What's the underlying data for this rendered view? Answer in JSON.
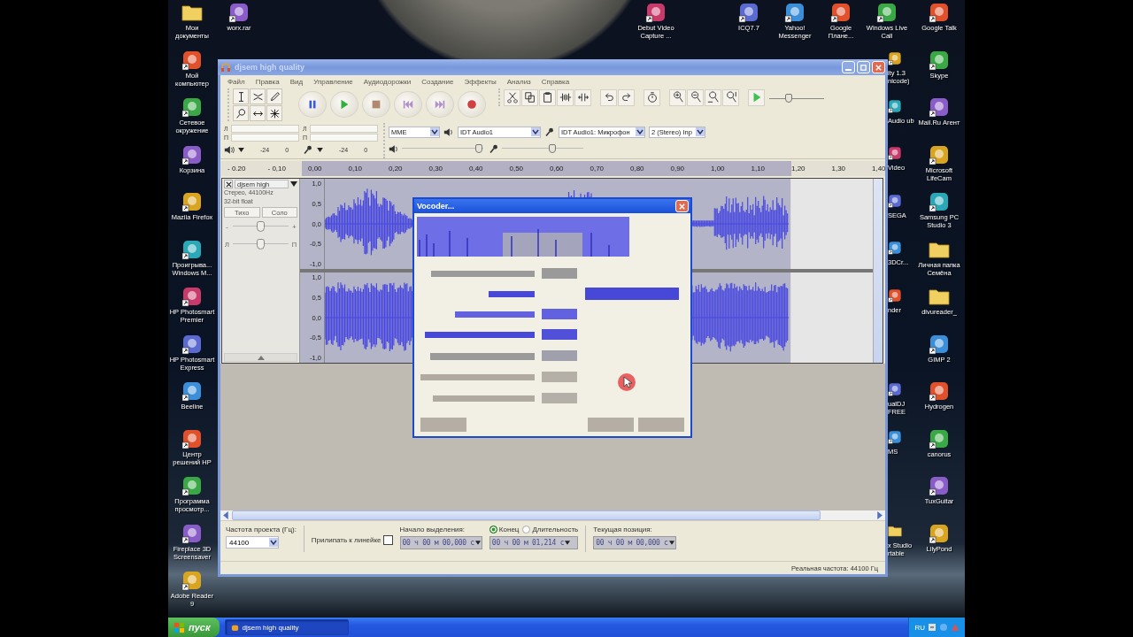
{
  "desktop": {
    "left_column": [
      {
        "label": "Мои документы",
        "kind": "folder"
      },
      {
        "label": "Мой компьютер",
        "kind": "app"
      },
      {
        "label": "Сетевое окружение",
        "kind": "app"
      },
      {
        "label": "Корзина",
        "kind": "app"
      },
      {
        "label": "Mazila Firefox",
        "kind": "app"
      },
      {
        "label": "Проигрыва... Windows M...",
        "kind": "app"
      },
      {
        "label": "HP Photosmart Premier",
        "kind": "app"
      },
      {
        "label": "HP Photosmart Express",
        "kind": "app"
      },
      {
        "label": "Beeline",
        "kind": "app"
      },
      {
        "label": "Центр решений HP",
        "kind": "app"
      },
      {
        "label": "Программа просмотр...",
        "kind": "app"
      },
      {
        "label": "Fireplace 3D Screensaver",
        "kind": "app"
      },
      {
        "label": "Adobe Reader 9",
        "kind": "app"
      }
    ],
    "second_column": [
      {
        "label": "worx.rar",
        "kind": "app"
      }
    ],
    "top_row": [
      {
        "label": "Debut Video Capture ...",
        "kind": "app"
      },
      {
        "label": "ICQ7.7",
        "kind": "app"
      },
      {
        "label": "Yahoo! Messenger",
        "kind": "app"
      },
      {
        "label": "Google Плане...",
        "kind": "app"
      },
      {
        "label": "Windows Live Call",
        "kind": "app"
      }
    ],
    "right_column": [
      {
        "label": "Google Talk",
        "kind": "app"
      },
      {
        "label": "Skype",
        "kind": "app"
      },
      {
        "label": "Mail.Ru Агент",
        "kind": "app"
      },
      {
        "label": "Microsoft LifeCam",
        "kind": "app"
      },
      {
        "label": "Samsung PC Studio 3",
        "kind": "app"
      },
      {
        "label": "Личная папка Семёна",
        "kind": "folder"
      },
      {
        "label": "divureader_",
        "kind": "folder"
      },
      {
        "label": "GIMP 2",
        "kind": "app"
      },
      {
        "label": "Hydrogen",
        "kind": "app"
      },
      {
        "label": "canorus",
        "kind": "app"
      },
      {
        "label": "TuxGuitar",
        "kind": "app"
      },
      {
        "label": "LilyPond",
        "kind": "app"
      }
    ],
    "partly_hidden_upper": [
      {
        "label": "ity 1.3 nicode)",
        "kind": "app"
      },
      {
        "label": "Audio ub",
        "kind": "app"
      },
      {
        "label": "Video",
        "kind": "app"
      },
      {
        "label": "SEGA",
        "kind": "app"
      },
      {
        "label": "3DCr...",
        "kind": "app"
      },
      {
        "label": "nder",
        "kind": "app"
      }
    ],
    "partly_hidden_lower": [
      {
        "label": "ualDJ FREE",
        "kind": "app"
      },
      {
        "label": "MS",
        "kind": "app"
      }
    ],
    "partly_hidden_bottom": [
      {
        "label": "x Studio rtable",
        "kind": "folder"
      }
    ]
  },
  "window": {
    "title": "djsem high quality",
    "menu": [
      "Файл",
      "Правка",
      "Вид",
      "Управление",
      "Аудиодорожки",
      "Создание",
      "Эффекты",
      "Анализ",
      "Справка"
    ],
    "play_speed": {
      "level": 0.35
    },
    "meter": {
      "playback_channels": [
        "Л",
        "П"
      ],
      "record_channels": [
        "Л",
        "П"
      ],
      "playback_scale": [
        "-24",
        "0"
      ],
      "record_scale": [
        "-24",
        "0"
      ]
    },
    "device": {
      "host": "MME",
      "output": "IDT Audio1",
      "input": "IDT Audio1: Микрофон",
      "channels": "2 (Stereo) Inp"
    },
    "mixer": [
      {
        "kind": "output",
        "level": 0.95
      },
      {
        "kind": "input",
        "level": 0.62
      }
    ],
    "ruler": [
      "- 0.20",
      "- 0,10",
      "0,00",
      "0,10",
      "0,20",
      "0,30",
      "0,40",
      "0,50",
      "0,60",
      "0,70",
      "0,80",
      "0,90",
      "1,00",
      "1,10",
      "1,20",
      "1,30",
      "1,40"
    ],
    "track": {
      "name": "djsem high",
      "info": [
        "Стерео, 44100Hz",
        "32-bit float"
      ],
      "mute": "Тихо",
      "solo": "Соло",
      "gain_marks": [
        "-",
        "+"
      ],
      "gain": {
        "level": 0.5
      },
      "pan_marks": [
        "Л",
        "П"
      ],
      "pan": {
        "level": 0.5
      },
      "channels": [
        {
          "kind": "speech",
          "axis": [
            "1,0",
            "0,5",
            "0,0",
            "-0,5",
            "-1,0"
          ]
        },
        {
          "kind": "dense",
          "axis": [
            "1,0",
            "0,5",
            "0,0",
            "-0,5",
            "-1,0"
          ]
        }
      ]
    },
    "selection_bar": {
      "rate_label": "Частота проекта (Гц):",
      "rate": "44100",
      "snap_label": "Прилипать к линейке",
      "snap_checked": false,
      "start_label": "Начало выделения:",
      "start": "00 ч 00 м 00,000 с",
      "end_modes": [
        {
          "label": "Конец",
          "selected": true
        },
        {
          "label": "Длительность",
          "selected": false
        }
      ],
      "end": "00 ч 00 м 01,214 с",
      "position_label": "Текущая позиция:",
      "position": "00 ч 00 м 00,000 с"
    },
    "status": "Реальная частота: 44100 Гц"
  },
  "dialog": {
    "title": "Vocoder..."
  },
  "taskbar": {
    "start": "пуск",
    "tasks": [
      {
        "label": "djsem high quality",
        "selected": true
      }
    ],
    "language": "RU"
  }
}
